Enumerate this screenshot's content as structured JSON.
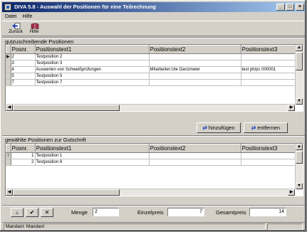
{
  "window": {
    "title": "DIVA 5.8 - Auswahl der Positionen für eine Teilrechnung",
    "min_glyph": "_",
    "max_glyph": "□",
    "close_glyph": "×"
  },
  "menu": [
    "Datei",
    "Hilfe"
  ],
  "toolbar": {
    "back_label": "Zurück",
    "help_label": "Hilfe"
  },
  "top_section": {
    "label": "gutzuschreibende Positionen",
    "columns": [
      "Posnr.",
      "Positionstext1",
      "Positionstext2",
      "Positionstext3"
    ],
    "rows": [
      {
        "ind": "▶",
        "posnr": "2",
        "text1": "Testposition 2",
        "text2": "",
        "text3": ""
      },
      {
        "ind": "",
        "posnr": "3",
        "text1": "Testposition 3",
        "text2": "",
        "text3": ""
      },
      {
        "ind": "",
        "posnr": "4",
        "text1": "Auswerten von Schweißprüfungen",
        "text2": "Mitarbeiter:Ute Ganzmeier",
        "text3": "test ph/pc 000001"
      },
      {
        "ind": "",
        "posnr": "5",
        "text1": "Testposition 5",
        "text2": "",
        "text3": ""
      },
      {
        "ind": "",
        "posnr": "7",
        "text1": "Testposition 7",
        "text2": "",
        "text3": ""
      }
    ]
  },
  "buttons": {
    "add_label": "hinzufügen",
    "remove_label": "entfernen"
  },
  "bottom_section": {
    "label": "gewählte Positionen zur Gutschrift",
    "columns": [
      "Posnr.",
      "Positionstext1",
      "Positionstext2",
      "Positionstext3"
    ],
    "rows": [
      {
        "ind": "I",
        "posnr": "1",
        "text1": "Testposition 1",
        "text2": "",
        "text3": ""
      },
      {
        "ind": "",
        "posnr": "2",
        "text1": "Testposition 6",
        "text2": "",
        "text3": ""
      }
    ]
  },
  "navigator": {
    "first_glyph": "▲",
    "ok_glyph": "✔",
    "cancel_glyph": "✕"
  },
  "fields": {
    "menge_label": "Menge",
    "menge_value": "2",
    "einzelpreis_label": "Einzelpreis",
    "einzelpreis_value": "7",
    "gesamtpreis_label": "Gesamtpreis",
    "gesamtpreis_value": "14"
  },
  "status": {
    "text": "Mandant: Mandant"
  }
}
